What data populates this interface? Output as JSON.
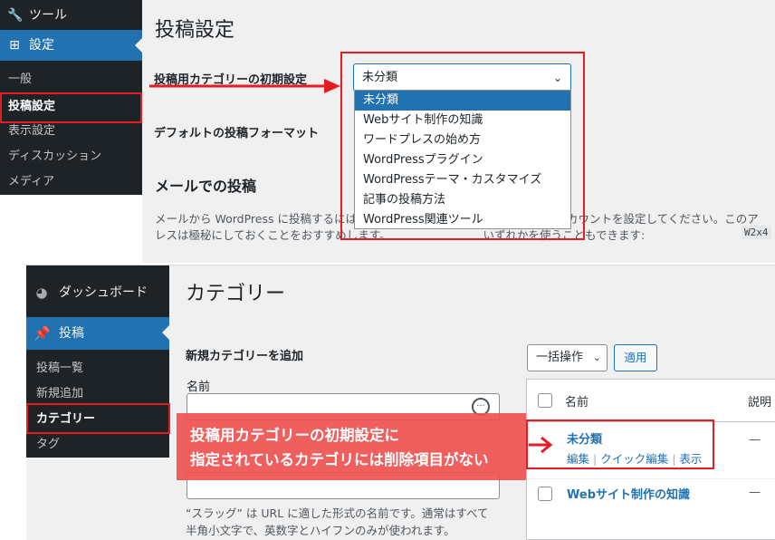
{
  "top": {
    "sidebar": {
      "tools_label": "ツール",
      "settings_label": "設定",
      "sub_items": [
        "一般",
        "投稿設定",
        "表示設定",
        "ディスカッション",
        "メディア"
      ]
    },
    "page_title": "投稿設定",
    "default_category_label": "投稿用カテゴリーの初期設定",
    "default_format_label": "デフォルトの投稿フォーマット",
    "category_select": {
      "value": "未分類",
      "options": [
        "未分類",
        "Webサイト制作の知識",
        "ワードプレスの始め方",
        "WordPressプラグイン",
        "WordPressテーマ・カスタマイズ",
        "記事の投稿方法",
        "WordPress関連ツール"
      ]
    },
    "mail_heading": "メールでの投稿",
    "mail_desc_line1": "メールから WordPress に投稿するには",
    "mail_desc_line1_tail": "カウントを設定してください。このア",
    "mail_desc_line2": "レスは極秘にしておくことをおすすめします。",
    "mail_desc_line2_tail": "いずれかを使うこともできます:",
    "code_sample": "W2x4"
  },
  "bottom": {
    "sidebar": {
      "dashboard_label": "ダッシュボード",
      "posts_label": "投稿",
      "sub_items": [
        "投稿一覧",
        "新規追加",
        "カテゴリー",
        "タグ"
      ]
    },
    "page_title": "カテゴリー",
    "add_heading": "新規カテゴリーを追加",
    "name_label": "名前",
    "slug_desc_line1": "“スラッグ” は URL に適した形式の名前です。通常はすべて",
    "slug_desc_line2": "半角小文字で、英数字とハイフンのみが使われます。",
    "bulk_action": "一括操作",
    "apply_button": "適用",
    "table": {
      "col_name": "名前",
      "col_desc": "説明",
      "rows": [
        {
          "name": "未分類",
          "actions": [
            "編集",
            "クイック編集",
            "表示"
          ],
          "desc": "—"
        },
        {
          "name": "Webサイト制作の知識",
          "desc": "—"
        }
      ]
    }
  },
  "callout": {
    "line1": "投稿用カテゴリーの初期設定に",
    "line2": "指定されているカテゴリには削除項目がない"
  },
  "colors": {
    "sidebar_bg": "#1d2327",
    "active_blue": "#2271b1",
    "highlight_red": "#e51c23",
    "callout_bg": "#ef5350"
  }
}
